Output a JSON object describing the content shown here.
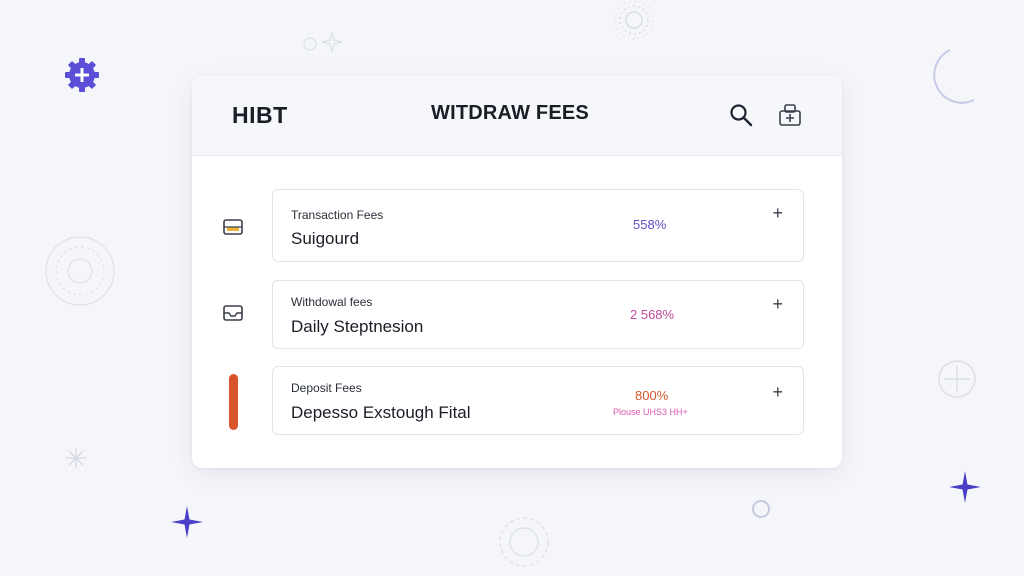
{
  "header": {
    "brand": "HIBT",
    "title": "WITDRAW FEES"
  },
  "icons": {
    "search": "search-icon",
    "share": "share-icon",
    "tray": "tray-icon",
    "status_bar": "status-bar-icon"
  },
  "fees": [
    {
      "label": "Transaction Fees",
      "value": "Suigourd",
      "percent": "558%",
      "percent_color": "#5a50c8",
      "note": ""
    },
    {
      "label": "Withdowal fees",
      "value": "Daily Steptnesion",
      "percent": "2 568%",
      "percent_color": "#c04a9a",
      "note": ""
    },
    {
      "label": "Deposit Fees",
      "value": "Depesso Exstough Fital",
      "percent": "800%",
      "percent_color": "#d4582a",
      "note": "Plouse UHS3 HH+"
    }
  ],
  "plus_symbol": "+",
  "colors": {
    "accent": "#5a4fd6",
    "orange_bar": "#d9542a",
    "background": "#f5f6fa"
  }
}
